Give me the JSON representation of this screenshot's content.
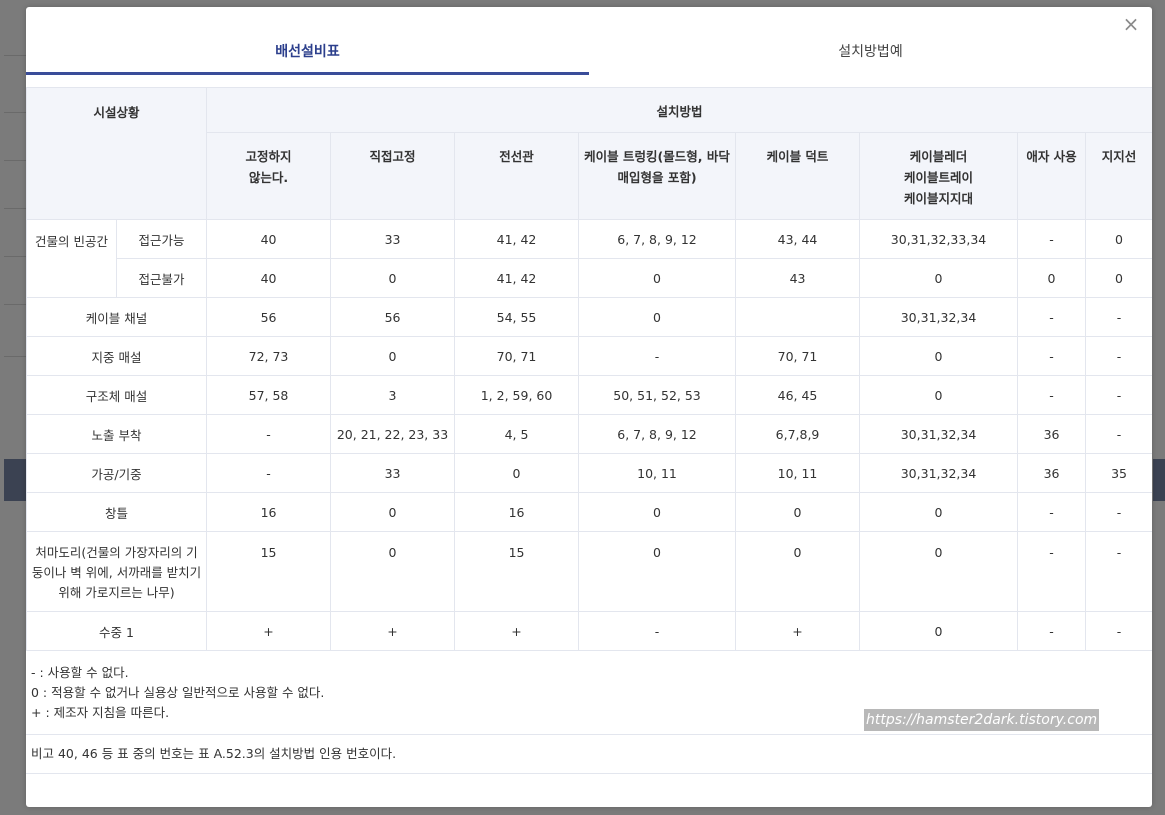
{
  "tabs": [
    {
      "label": "배선설비표"
    },
    {
      "label": "설치방법예"
    }
  ],
  "close_symbol": "×",
  "table": {
    "header_situation": "시설상황",
    "header_method": "설치방법",
    "columns": [
      [
        "고정하지",
        "않는다."
      ],
      [
        "직접고정"
      ],
      [
        "전선관"
      ],
      [
        "케이블 트렁킹(몰드형, 바닥",
        "매입형을 포함)"
      ],
      [
        "케이블 덕트"
      ],
      [
        "케이블레더",
        "케이블트레이",
        "케이블지지대"
      ],
      [
        "애자 사용"
      ],
      [
        "지지선"
      ]
    ],
    "rows": [
      {
        "group": "건물의 빈공간",
        "sub": "접근가능",
        "values": [
          "40",
          "33",
          "41, 42",
          "6, 7, 8, 9, 12",
          "43, 44",
          "30,31,32,33,34",
          "-",
          "0"
        ]
      },
      {
        "group": "",
        "sub": "접근불가",
        "values": [
          "40",
          "0",
          "41, 42",
          "0",
          "43",
          "0",
          "0",
          "0"
        ]
      },
      {
        "label": "케이블 채널",
        "values": [
          "56",
          "56",
          "54, 55",
          "0",
          "",
          "30,31,32,34",
          "-",
          "-"
        ]
      },
      {
        "label": "지중 매설",
        "values": [
          "72, 73",
          "0",
          "70, 71",
          "-",
          "70, 71",
          "0",
          "-",
          "-"
        ]
      },
      {
        "label": "구조체 매설",
        "values": [
          "57, 58",
          "3",
          "1, 2, 59, 60",
          "50, 51, 52, 53",
          "46, 45",
          "0",
          "-",
          "-"
        ]
      },
      {
        "label": "노출 부착",
        "values": [
          "-",
          "20, 21, 22, 23, 33",
          "4, 5",
          "6, 7, 8, 9, 12",
          "6,7,8,9",
          "30,31,32,34",
          "36",
          "-"
        ]
      },
      {
        "label": "가공/기중",
        "values": [
          "-",
          "33",
          "0",
          "10, 11",
          "10, 11",
          "30,31,32,34",
          "36",
          "35"
        ]
      },
      {
        "label": "창틀",
        "values": [
          "16",
          "0",
          "16",
          "0",
          "0",
          "0",
          "-",
          "-"
        ]
      },
      {
        "label_lines": [
          "처마도리(건물의 가장자리의 기",
          "둥이나 벽 위에, 서까래를 받치기",
          "위해 가로지르는 나무)"
        ],
        "values": [
          "15",
          "0",
          "15",
          "0",
          "0",
          "0",
          "-",
          "-"
        ]
      },
      {
        "label": "수중 1",
        "values": [
          "+",
          "+",
          "+",
          "-",
          "+",
          "0",
          "-",
          "-"
        ]
      }
    ]
  },
  "notes": [
    "- : 사용할 수 없다.",
    "0 : 적용할 수 없거나 실용상 일반적으로 사용할 수 없다.",
    "+ : 제조자 지침을 따른다."
  ],
  "remark": "비고 40, 46 등 표 중의 번호는 표 A.52.3의 설치방법 인용 번호이다.",
  "watermark": "https://hamster2dark.tistory.com",
  "colors": {
    "accent": "#3a4d99",
    "active_tab_text": "#2c3f8c",
    "header_bg": "#f3f5fa",
    "border": "#e3e6ee",
    "overlay": "#7b7b7b"
  }
}
